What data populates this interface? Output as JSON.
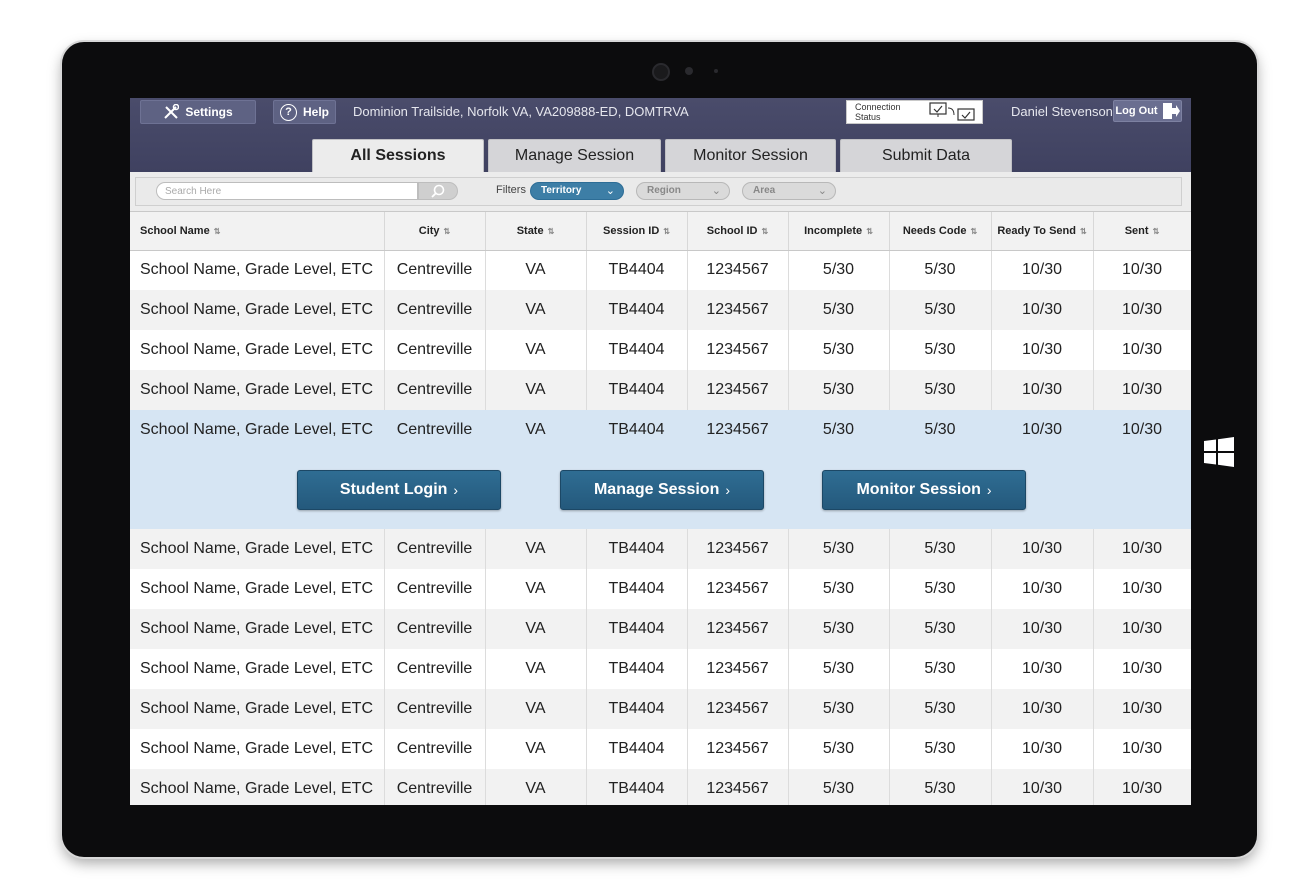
{
  "header": {
    "settings_label": "Settings",
    "help_label": "Help",
    "location": "Dominion Trailside, Norfolk VA, VA209888-ED, DOMTRVA",
    "connection_status_label": "Connection Status",
    "user_name": "Daniel Stevenson",
    "logout_label": "Log Out"
  },
  "tabs": [
    {
      "label": "All Sessions",
      "active": true
    },
    {
      "label": "Manage Session",
      "active": false
    },
    {
      "label": "Monitor Session",
      "active": false
    },
    {
      "label": "Submit Data",
      "active": false
    }
  ],
  "filterbar": {
    "search_placeholder": "Search Here",
    "filters_label": "Filters",
    "territory": "Territory",
    "region": "Region",
    "area": "Area"
  },
  "table": {
    "columns": [
      "School Name",
      "City",
      "State",
      "Session ID",
      "School ID",
      "Incomplete",
      "Needs Code",
      "Ready To Send",
      "Sent"
    ],
    "rows": [
      [
        "School Name, Grade Level, ETC",
        "Centreville",
        "VA",
        "TB4404",
        "1234567",
        "5/30",
        "5/30",
        "10/30",
        "10/30"
      ],
      [
        "School Name, Grade Level, ETC",
        "Centreville",
        "VA",
        "TB4404",
        "1234567",
        "5/30",
        "5/30",
        "10/30",
        "10/30"
      ],
      [
        "School Name, Grade Level, ETC",
        "Centreville",
        "VA",
        "TB4404",
        "1234567",
        "5/30",
        "5/30",
        "10/30",
        "10/30"
      ],
      [
        "School Name, Grade Level, ETC",
        "Centreville",
        "VA",
        "TB4404",
        "1234567",
        "5/30",
        "5/30",
        "10/30",
        "10/30"
      ],
      [
        "School Name, Grade Level, ETC",
        "Centreville",
        "VA",
        "TB4404",
        "1234567",
        "5/30",
        "5/30",
        "10/30",
        "10/30"
      ],
      [
        "School Name, Grade Level, ETC",
        "Centreville",
        "VA",
        "TB4404",
        "1234567",
        "5/30",
        "5/30",
        "10/30",
        "10/30"
      ],
      [
        "School Name, Grade Level, ETC",
        "Centreville",
        "VA",
        "TB4404",
        "1234567",
        "5/30",
        "5/30",
        "10/30",
        "10/30"
      ],
      [
        "School Name, Grade Level, ETC",
        "Centreville",
        "VA",
        "TB4404",
        "1234567",
        "5/30",
        "5/30",
        "10/30",
        "10/30"
      ],
      [
        "School Name, Grade Level, ETC",
        "Centreville",
        "VA",
        "TB4404",
        "1234567",
        "5/30",
        "5/30",
        "10/30",
        "10/30"
      ],
      [
        "School Name, Grade Level, ETC",
        "Centreville",
        "VA",
        "TB4404",
        "1234567",
        "5/30",
        "5/30",
        "10/30",
        "10/30"
      ],
      [
        "School Name, Grade Level, ETC",
        "Centreville",
        "VA",
        "TB4404",
        "1234567",
        "5/30",
        "5/30",
        "10/30",
        "10/30"
      ],
      [
        "School Name, Grade Level, ETC",
        "Centreville",
        "VA",
        "TB4404",
        "1234567",
        "5/30",
        "5/30",
        "10/30",
        "10/30"
      ]
    ],
    "selected_row": 4,
    "row_actions": [
      "Student Login",
      "Manage Session",
      "Monitor Session"
    ]
  },
  "icons": {
    "settings": "tools-icon",
    "help": "question-circle-icon",
    "connection": "monitors-check-icon",
    "logout": "logout-door-icon",
    "search": "magnifier-icon",
    "sort": "sort-arrows-icon",
    "chevron": "chevron-right-icon"
  },
  "colors": {
    "header_bg": "#45476a",
    "accent_blue": "#3d7ea6",
    "action_button": "#2a6488",
    "selected_row": "#d6e5f3"
  }
}
